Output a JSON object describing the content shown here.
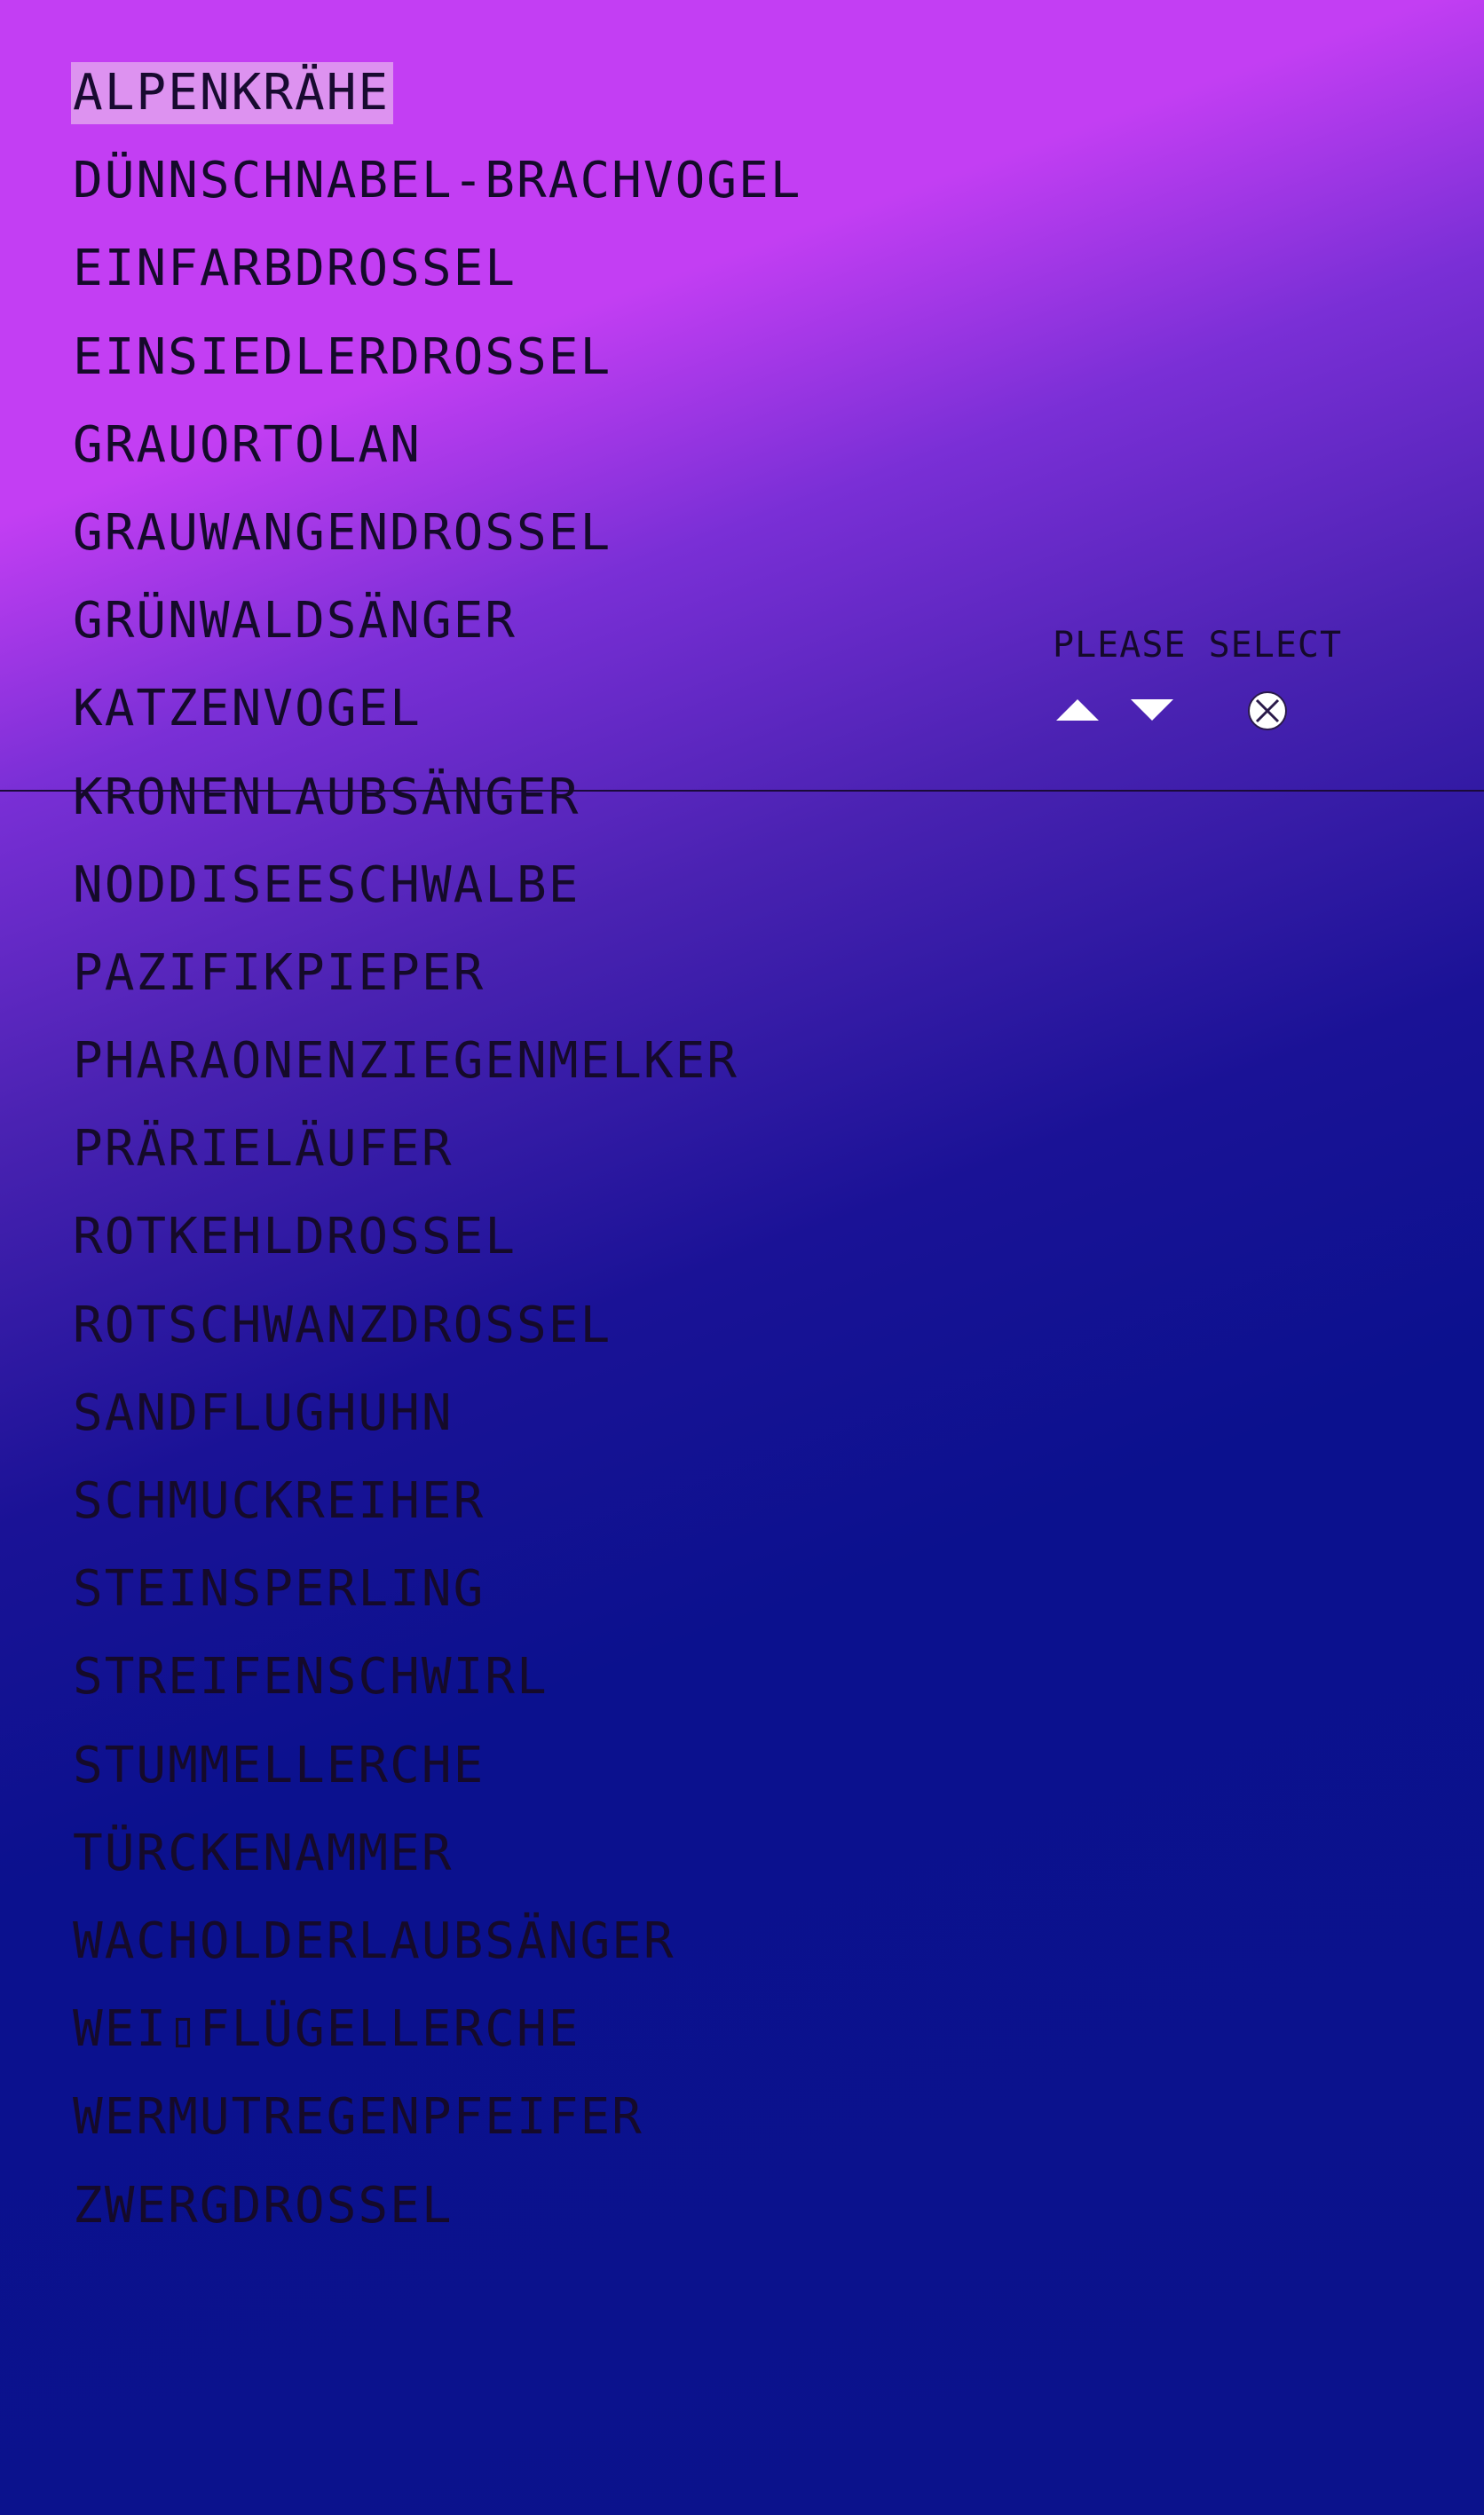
{
  "menu": {
    "items": [
      "ALPENKRÄHE",
      "DÜNNSCHNABEL-BRACHVOGEL",
      "EINFARBDROSSEL",
      "EINSIEDLERDROSSEL",
      "GRAUORTOLAN",
      "GRAUWANGENDROSSEL",
      "GRÜNWALDSÄNGER",
      "KATZENVOGEL",
      "KRONENLAUBSÄNGER",
      "NODDISEESCHWALBE",
      "PAZIFIKPIEPER",
      "PHARAONENZIEGENMELKER",
      "PRÄRIELÄUFER",
      "ROTKEHLDROSSEL",
      "ROTSCHWANZDROSSEL",
      "SANDFLUGHUHN",
      "SCHMUCKREIHER",
      "STEINSPERLING",
      "STREIFENSCHWIRL",
      "STUMMELLERCHE",
      "TÜRCKENAMMER",
      "WACHOLDERLAUBSÄNGER",
      "WEI▯FLÜGELLERCHE",
      "WERMUTREGENPFEIFER",
      "ZWERGDROSSEL"
    ],
    "selected_index": 0
  },
  "prompt": {
    "text": "PLEASE SELECT"
  },
  "controls": {
    "up_icon": "triangle-up-icon",
    "down_icon": "triangle-down-icon",
    "close_icon": "close-circle-icon"
  },
  "colors": {
    "background_top": "#c33ef3",
    "background_bottom": "#0b128c",
    "highlight": "#dd92f0",
    "text": "#150a2a",
    "icon": "#ffffff"
  }
}
